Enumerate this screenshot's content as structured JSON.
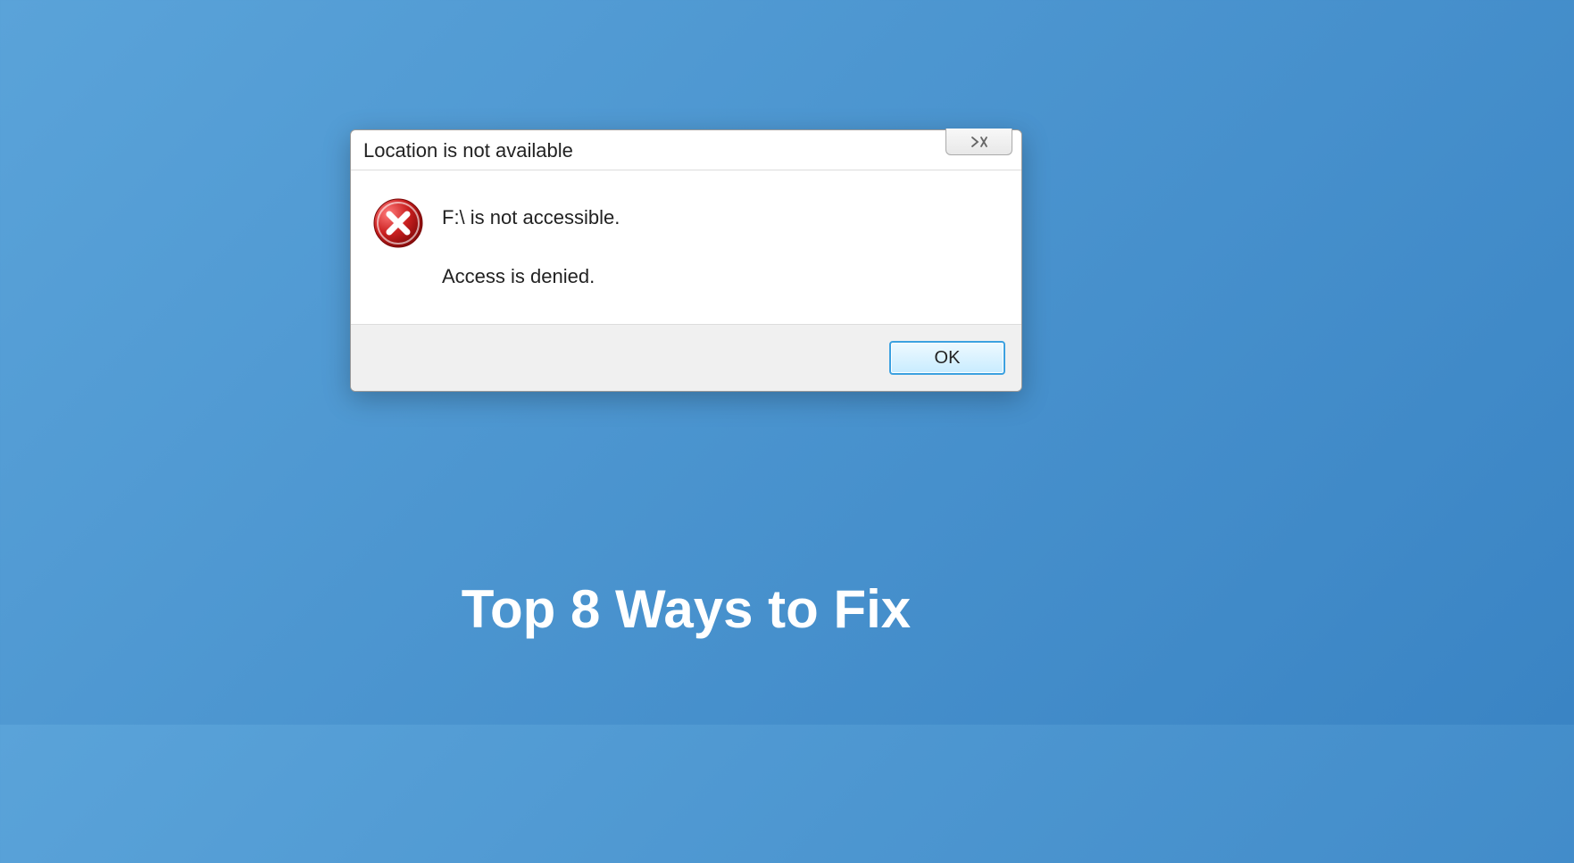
{
  "dialog": {
    "title": "Location is not available",
    "close_label": "✕",
    "message_line1": "F:\\ is not accessible.",
    "message_line2": "Access is denied.",
    "ok_label": "OK"
  },
  "caption": "Top 8 Ways to Fix"
}
